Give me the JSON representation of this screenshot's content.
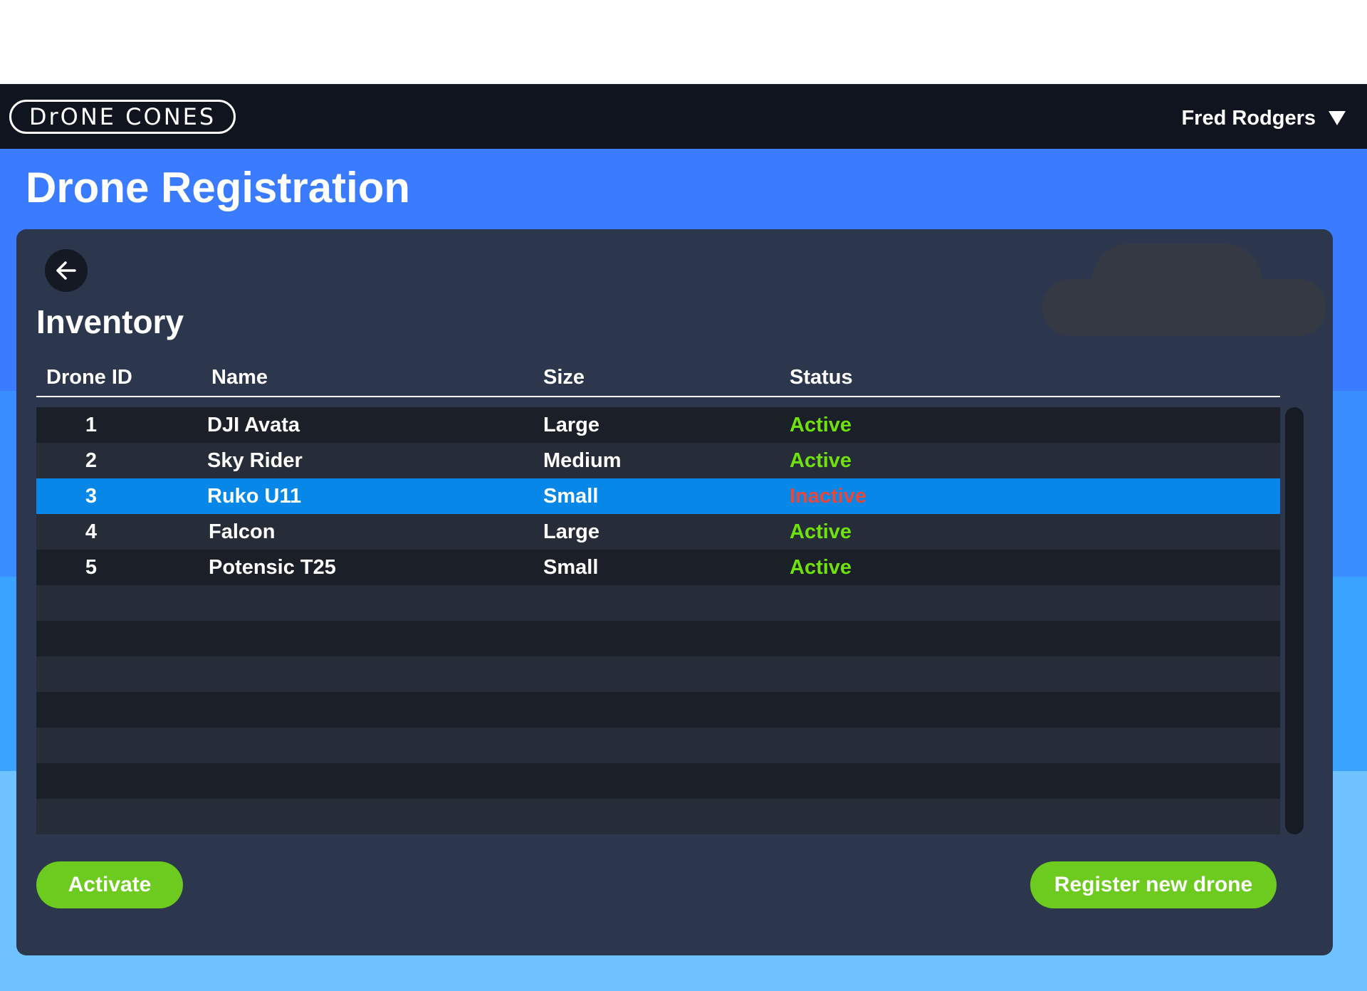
{
  "header": {
    "logo_text": "DrONE CONES",
    "user_name": "Fred Rodgers"
  },
  "page": {
    "title": "Drone Registration"
  },
  "inventory": {
    "title": "Inventory",
    "columns": [
      "Drone ID",
      "Name",
      "Size",
      "Status"
    ],
    "rows": [
      {
        "id": "1",
        "name": "DJI Avata",
        "size": "Large",
        "status": "Active"
      },
      {
        "id": "2",
        "name": "Sky Rider",
        "size": "Medium",
        "status": "Active"
      },
      {
        "id": "3",
        "name": "Ruko U11",
        "size": "Small",
        "status": "Inactive"
      },
      {
        "id": "4",
        "name": "Falcon",
        "size": "Large",
        "status": "Active"
      },
      {
        "id": "5",
        "name": "Potensic T25",
        "size": "Small",
        "status": "Active"
      }
    ],
    "selected_row_id": "3"
  },
  "actions": {
    "activate_label": "Activate",
    "register_label": "Register new drone"
  },
  "colors": {
    "header_bg": "#10141f",
    "panel_bg": "#2c374d",
    "selected_row": "#0788e9",
    "status_active": "#6fe10c",
    "status_inactive": "#e8473a",
    "button_green": "#6ccb1e"
  },
  "icons": {
    "back": "arrow-left-icon",
    "user_menu": "caret-down-icon"
  }
}
